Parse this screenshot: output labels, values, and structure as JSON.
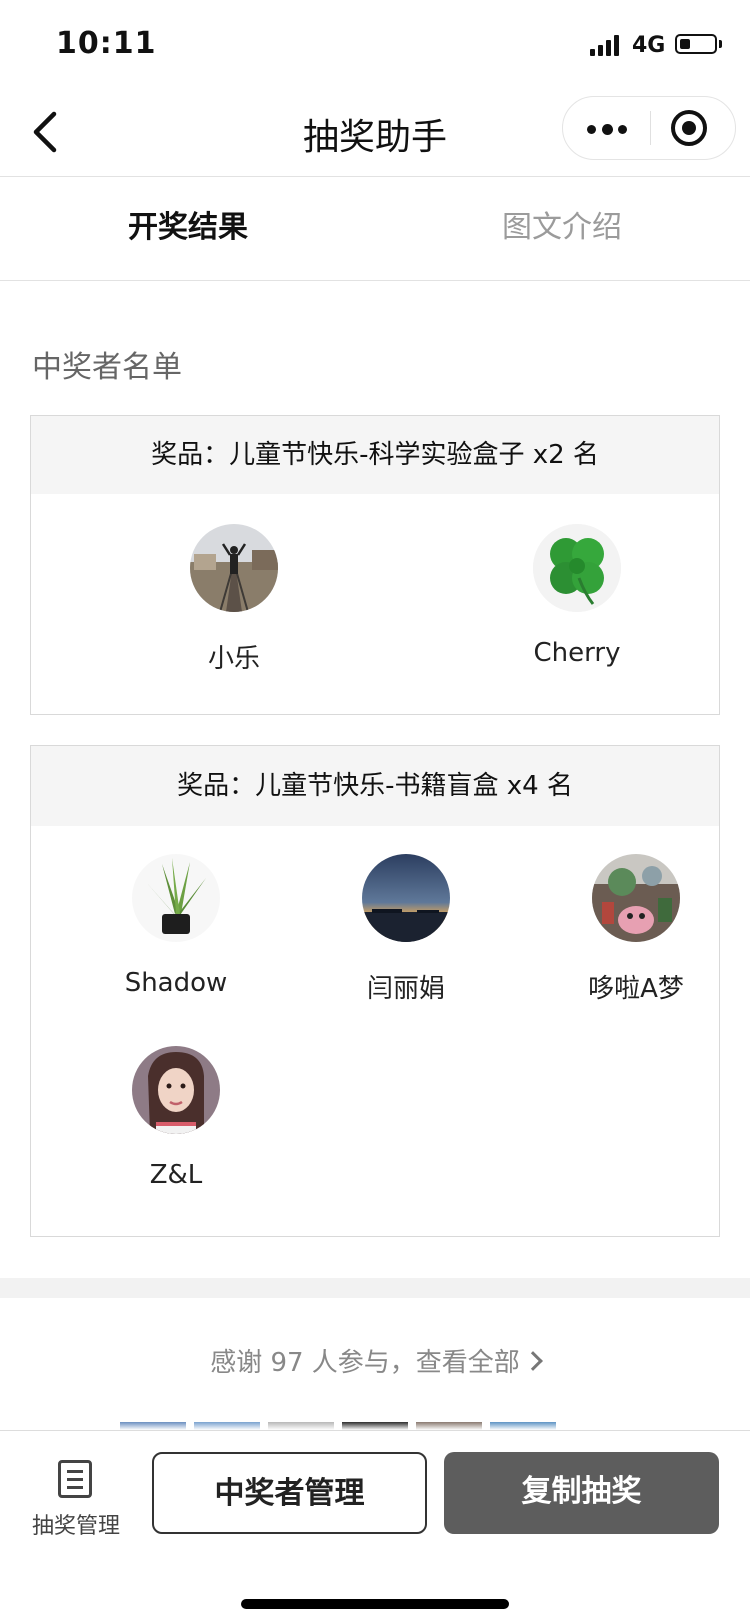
{
  "status_bar": {
    "time": "10:11",
    "network": "4G",
    "battery_level": 0.3
  },
  "nav": {
    "title": "抽奖助手"
  },
  "tabs": [
    {
      "label": "开奖结果",
      "active": true
    },
    {
      "label": "图文介绍",
      "active": false
    }
  ],
  "section_title": "中奖者名单",
  "prizes": [
    {
      "label": "奖品：儿童节快乐-科学实验盒子 x2 名",
      "winners": [
        {
          "name": "小乐",
          "avatar": "railway-photo"
        },
        {
          "name": "Cherry",
          "avatar": "clover"
        }
      ]
    },
    {
      "label": "奖品：儿童节快乐-书籍盲盒 x4 名",
      "winners": [
        {
          "name": "Shadow",
          "avatar": "aloe-plant"
        },
        {
          "name": "闫丽娟",
          "avatar": "sunset-sea"
        },
        {
          "name": "哆啦A梦",
          "avatar": "toy-figures"
        },
        {
          "name": "Z&L",
          "avatar": "portrait-girl"
        }
      ]
    }
  ],
  "thanks_text": "感谢 97 人参与，查看全部",
  "bottom_bar": {
    "manage_label": "抽奖管理",
    "winner_manage_button": "中奖者管理",
    "copy_button": "复制抽奖"
  },
  "colors": {
    "primary_button": "#5d5d5d",
    "card_header_bg": "#f5f5f5",
    "muted_text": "#888888"
  }
}
